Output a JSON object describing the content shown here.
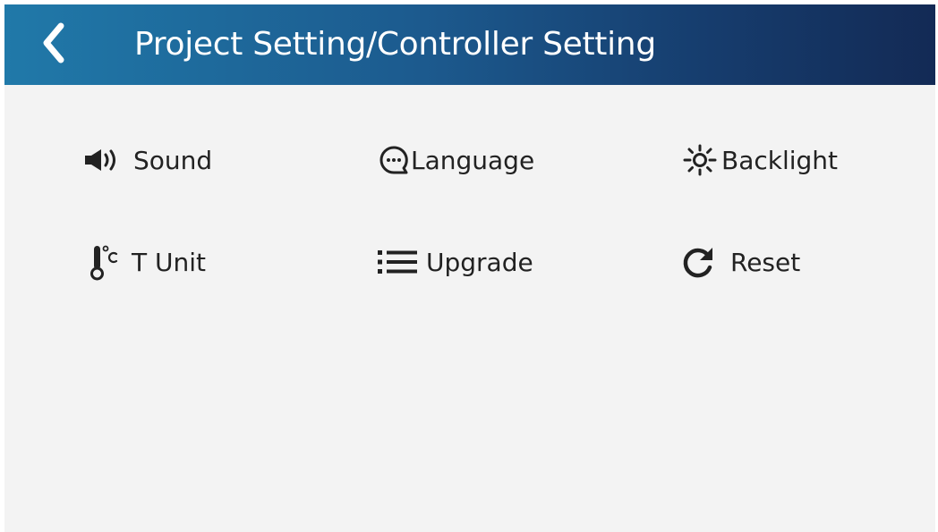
{
  "header": {
    "title": "Project Setting/Controller Setting",
    "back_icon": "chevron-left-icon"
  },
  "settings": [
    {
      "label": "Sound",
      "icon": "speaker-icon"
    },
    {
      "label": "Language",
      "icon": "chat-bubble-icon"
    },
    {
      "label": "Backlight",
      "icon": "sun-icon"
    },
    {
      "label": "T Unit",
      "icon": "thermometer-icon"
    },
    {
      "label": "Upgrade",
      "icon": "list-icon"
    },
    {
      "label": "Reset",
      "icon": "refresh-icon"
    }
  ],
  "colors": {
    "header_start": "#2079a9",
    "header_end": "#132a55",
    "background": "#f3f3f3",
    "text": "#222222"
  }
}
